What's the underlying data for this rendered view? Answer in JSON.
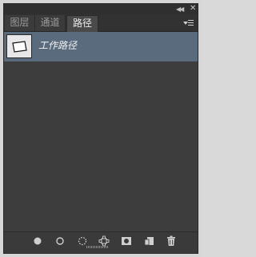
{
  "window": {
    "collapse_icon": "double-chevron-left-icon",
    "close_icon": "close-icon"
  },
  "tabs": [
    {
      "label": "图层",
      "active": false
    },
    {
      "label": "通道",
      "active": false
    },
    {
      "label": "路径",
      "active": true
    }
  ],
  "panel_menu_icon": "panel-menu-icon",
  "paths": [
    {
      "name": "工作路径",
      "selected": true
    }
  ],
  "toolbar": {
    "buttons": [
      {
        "name": "fill-path-icon"
      },
      {
        "name": "stroke-path-icon"
      },
      {
        "name": "load-as-selection-icon"
      },
      {
        "name": "make-work-path-icon"
      },
      {
        "name": "add-mask-icon"
      },
      {
        "name": "new-path-icon"
      },
      {
        "name": "delete-path-icon"
      }
    ]
  },
  "colors": {
    "panel_bg": "#3d3d3d",
    "selected_row": "#5a6b7e",
    "active_tab": "#4a4a4a"
  }
}
